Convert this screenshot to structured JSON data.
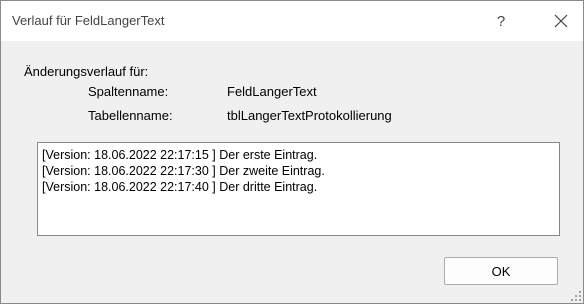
{
  "dialog": {
    "title": "Verlauf für FeldLangerText",
    "help_label": "?",
    "close_icon": "close-icon"
  },
  "info": {
    "heading": "Änderungsverlauf für:",
    "column_label": "Spaltenname:",
    "column_value": "FeldLangerText",
    "table_label": "Tabellenname:",
    "table_value": "tblLangerTextProtokollierung"
  },
  "history": {
    "entries": [
      "[Version: 18.06.2022 22:17:15 ] Der erste Eintrag.",
      "[Version: 18.06.2022 22:17:30 ] Der zweite Eintrag.",
      "[Version: 18.06.2022 22:17:40 ] Der dritte Eintrag."
    ]
  },
  "buttons": {
    "ok_label": "OK"
  }
}
